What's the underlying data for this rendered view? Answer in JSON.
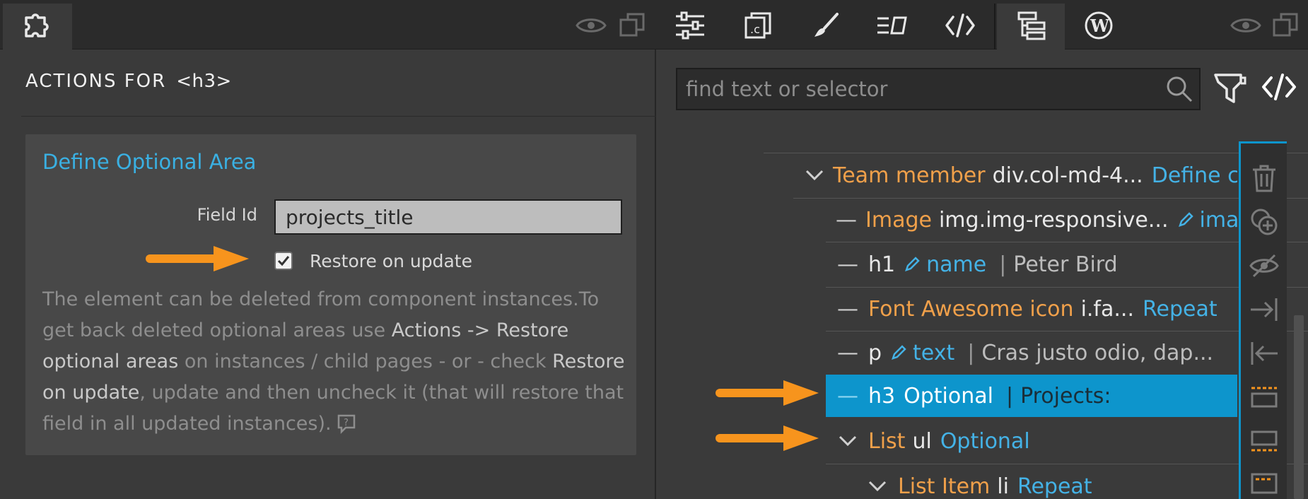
{
  "toolbar": {
    "icons": [
      "puzzle-icon",
      "eye-icon",
      "duplicate-icon",
      "sliders-icon",
      "code-file-icon",
      "brush-icon",
      "text-list-icon",
      "code-icon",
      "tree-icon",
      "wordpress-icon",
      "eye-icon",
      "duplicate-icon"
    ],
    "active": "puzzle-icon"
  },
  "left": {
    "title": "ACTIONS FOR",
    "tag": "<h3>",
    "card": {
      "title": "Define Optional Area",
      "field_label": "Field Id",
      "field_value": "projects_title",
      "checkbox_label": "Restore on update",
      "checkbox_checked": true,
      "description": {
        "p1": "The element can be deleted from component instances.To get back deleted optional areas use ",
        "h1": "Actions -> Restore optional areas",
        "p2": " on instances / child pages - or - check ",
        "h2": "Restore on update",
        "p3": ", update and then uncheck it (that will restore that field in all updated instances)."
      }
    }
  },
  "right": {
    "search_placeholder": "find text or selector",
    "tree": [
      {
        "symbol": "chevron-down-icon",
        "name": "Team member",
        "selector": "div.col-md-4...",
        "extra": "Define co"
      },
      {
        "symbol": "dash",
        "name": "Image",
        "selector": "img.img-responsive...",
        "field": "image"
      },
      {
        "symbol": "dash",
        "selector": "h1",
        "field": "name",
        "text": "Peter Bird"
      },
      {
        "symbol": "dash",
        "name": "Font Awesome icon",
        "selector": "i.fa...",
        "extra": "Repeat"
      },
      {
        "symbol": "dash",
        "selector": "p",
        "field": "text",
        "text": "Cras justo odio, dap..."
      },
      {
        "symbol": "dash",
        "selector": "h3",
        "extra": "Optional",
        "text": "Projects:"
      },
      {
        "symbol": "chevron-down-icon",
        "name": "List",
        "selector": "ul",
        "extra": "Optional"
      },
      {
        "symbol": "chevron-down-icon",
        "name": "List Item",
        "selector": "li",
        "extra": "Repeat"
      }
    ]
  },
  "sidebar_icons": [
    "trash-icon",
    "add-circle-icon",
    "hide-icon",
    "move-in-icon",
    "move-out-icon",
    "insert-before-icon",
    "insert-after-icon",
    "wrap-icon"
  ],
  "colors": {
    "accent": "#0d95cc",
    "link": "#44b2e6",
    "orange": "#f0a04a",
    "arrow": "#f7941d"
  }
}
